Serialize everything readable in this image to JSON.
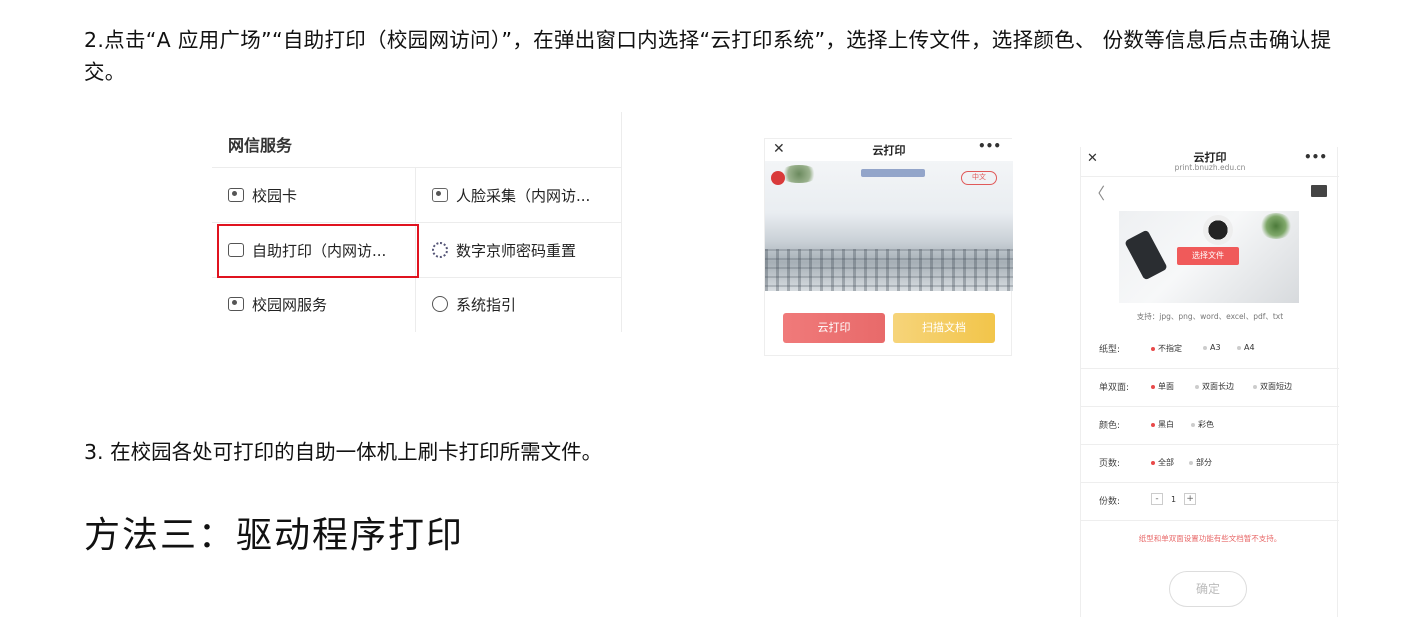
{
  "doc": {
    "step2": "2.点击“A 应用广场”“自助打印（校园网访问）”，在弹出窗口内选择“云打印系统”，选择上传文件，选择颜色、 份数等信息后点击确认提交。",
    "step3": "3.  在校园各处可打印的自助一体机上刷卡打印所需文件。",
    "heading": "方法三：驱动程序打印"
  },
  "menu": {
    "title": "网信服务",
    "items": [
      {
        "label": "校园卡",
        "icon": "card-icon"
      },
      {
        "label": "人脸采集（内网访...",
        "icon": "face-scan-icon"
      },
      {
        "label": "自助打印（内网访...",
        "icon": "printer-icon"
      },
      {
        "label": "数字京师密码重置",
        "icon": "gear-icon"
      },
      {
        "label": "校园网服务",
        "icon": "network-icon"
      },
      {
        "label": "系统指引",
        "icon": "guide-icon"
      }
    ],
    "highlight_color": "#e0131f"
  },
  "phone1": {
    "close": "✕",
    "title": "云打印",
    "more": "•••",
    "pill": "中文",
    "buttons": [
      "云打印",
      "扫描文档"
    ]
  },
  "phone2": {
    "close": "✕",
    "title": "云打印",
    "domain": "print.bnuzh.edu.cn",
    "more": "•••",
    "back": "〈",
    "select_file": "选择文件",
    "support": "支持：jpg、png、word、excel、pdf、txt",
    "rows": [
      {
        "label": "纸型:",
        "options": [
          "不指定",
          "A3",
          "A4"
        ],
        "selected": 0
      },
      {
        "label": "单双面:",
        "options": [
          "单面",
          "双面长边",
          "双面短边"
        ],
        "selected": 0
      },
      {
        "label": "颜色:",
        "options": [
          "黑白",
          "彩色"
        ],
        "selected": 0
      },
      {
        "label": "页数:",
        "options": [
          "全部",
          "部分"
        ],
        "selected": 0
      }
    ],
    "copies_label": "份数:",
    "copies_minus": "-",
    "copies_value": "1",
    "copies_plus": "+",
    "note": "纸型和单双面设置功能有些文档暂不支持。",
    "confirm": "确定",
    "accent": "#e84a4a"
  }
}
